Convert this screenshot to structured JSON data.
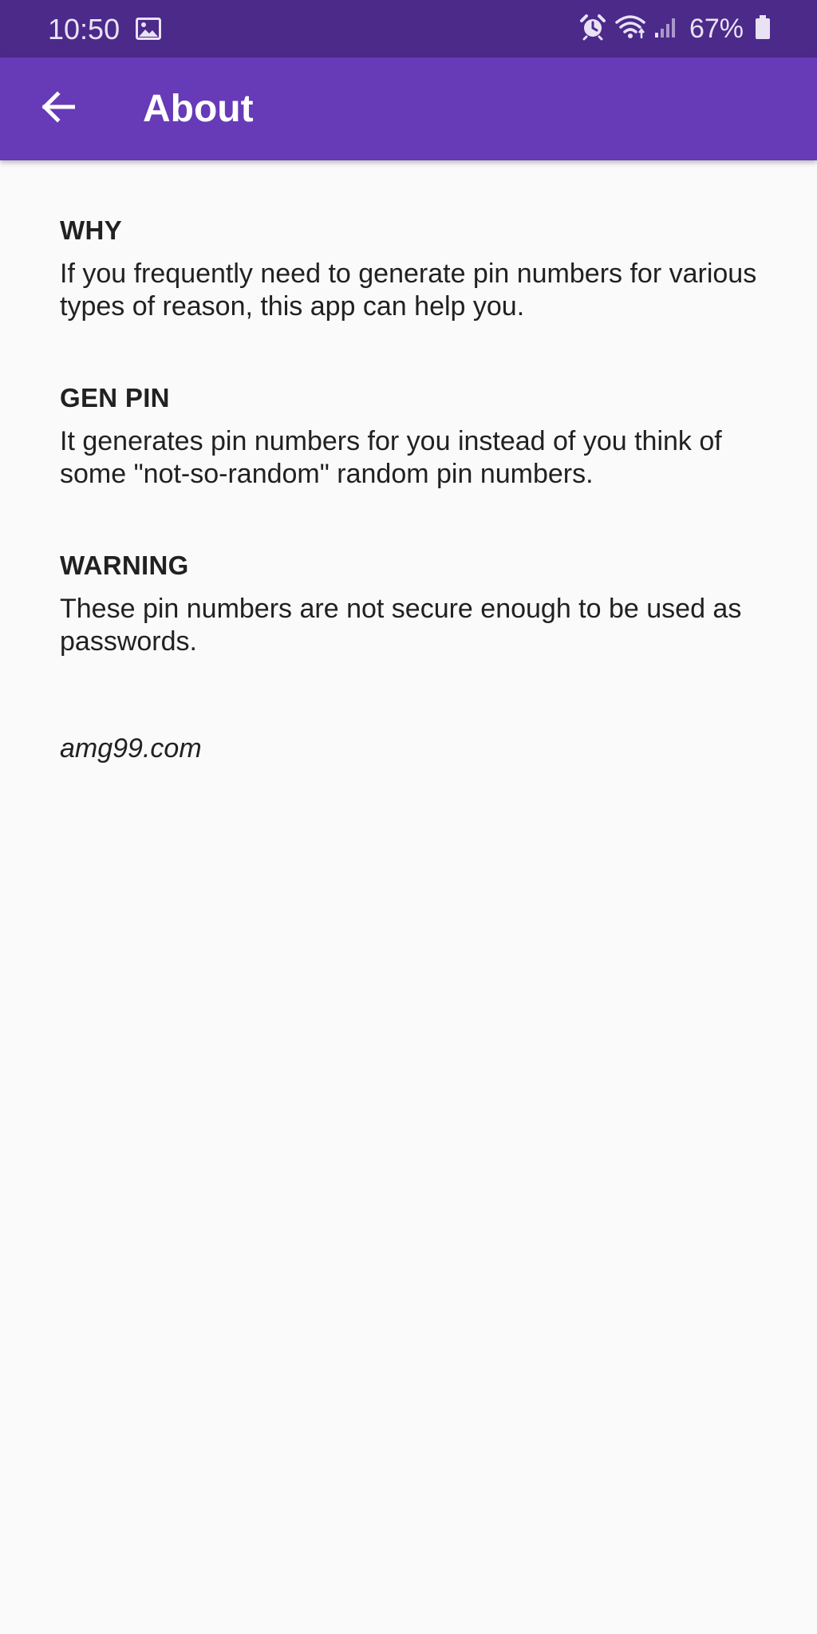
{
  "status_bar": {
    "time": "10:50",
    "battery": "67%",
    "icons": [
      "gallery-icon",
      "alarm-icon",
      "wifi-icon",
      "signal-icon",
      "battery-icon"
    ]
  },
  "app_bar": {
    "title": "About",
    "back_icon": "arrow-back-icon",
    "color": "#673ab7",
    "status_color": "#4b2a8a"
  },
  "sections": [
    {
      "heading": "WHY",
      "body": "If you frequently need to generate pin numbers for various types of reason, this app can help you."
    },
    {
      "heading": "GEN PIN",
      "body": "It generates pin numbers for you instead of you think of some \"not-so-random\" random pin numbers."
    },
    {
      "heading": "WARNING",
      "body": "These pin numbers are not secure enough to be used as passwords."
    }
  ],
  "footer": {
    "website": "amg99.com"
  }
}
